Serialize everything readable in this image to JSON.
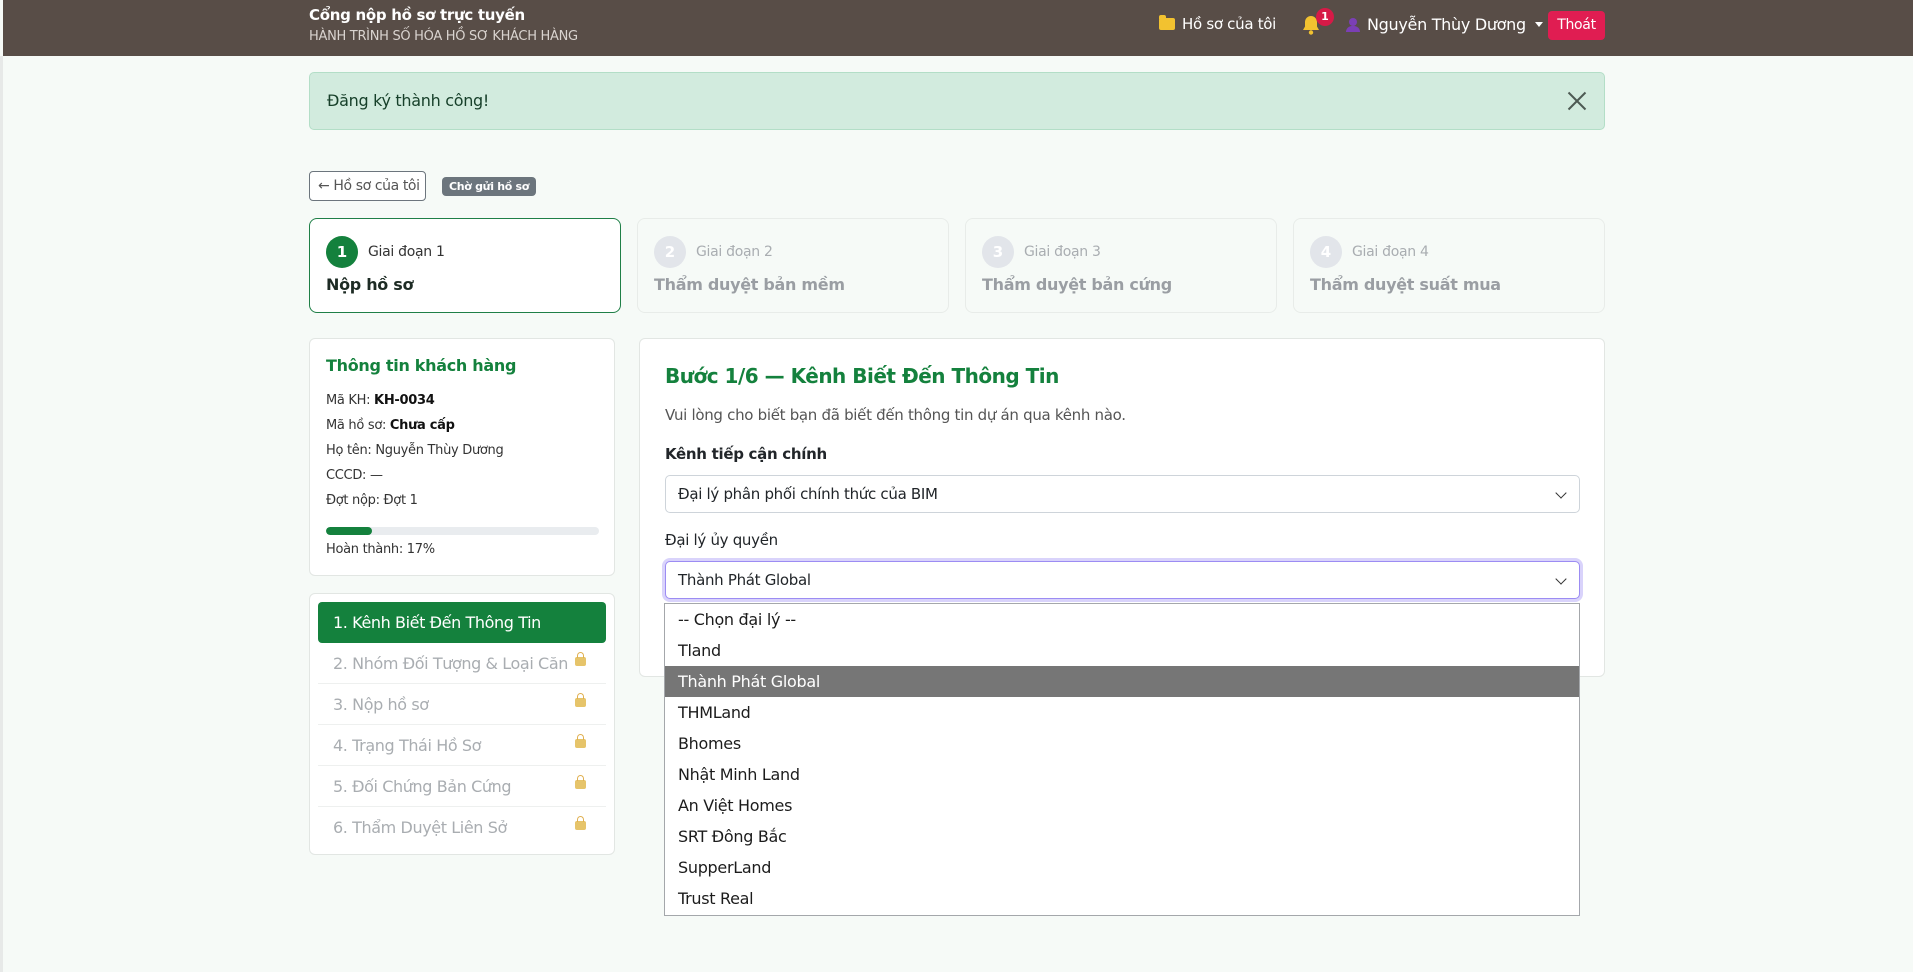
{
  "header": {
    "title": "Cổng nộp hồ sơ trực tuyến",
    "subtitle": "HÀNH TRÌNH SỐ HÓA HỒ SƠ KHÁCH HÀNG",
    "my_files": "Hồ sơ của tôi",
    "notification_count": "1",
    "user_name": "Nguyễn Thùy Dương",
    "logout": "Thoát"
  },
  "alert": {
    "message": "Đăng ký thành công!"
  },
  "toolbar": {
    "back_label": "← Hồ sơ của tôi",
    "status": "Chờ gửi hồ sơ"
  },
  "stages": [
    {
      "num": "1",
      "label": "Giai đoạn 1",
      "title": "Nộp hồ sơ"
    },
    {
      "num": "2",
      "label": "Giai đoạn 2",
      "title": "Thẩm duyệt bản mềm"
    },
    {
      "num": "3",
      "label": "Giai đoạn 3",
      "title": "Thẩm duyệt bản cứng"
    },
    {
      "num": "4",
      "label": "Giai đoạn 4",
      "title": "Thẩm duyệt suất mua"
    }
  ],
  "customer": {
    "heading": "Thông tin khách hàng",
    "customer_id_label": "Mã KH:",
    "customer_id": "KH-0034",
    "file_id_label": "Mã hồ sơ:",
    "file_id": "Chưa cấp",
    "name_label": "Họ tên:",
    "name": "Nguyễn Thùy Dương",
    "cccd_label": "CCCD:",
    "cccd": "—",
    "batch_label": "Đợt nộp:",
    "batch": "Đợt 1",
    "progress_percent": 17,
    "progress_text": "Hoàn thành: 17%"
  },
  "steps": [
    "1. Kênh Biết Đến Thông Tin",
    "2. Nhóm Đối Tượng & Loại Căn",
    "3. Nộp hồ sơ",
    "4. Trạng Thái Hồ Sơ",
    "5. Đối Chứng Bản Cứng",
    "6. Thẩm Duyệt Liên Sở"
  ],
  "form": {
    "title": "Bước 1/6 — Kênh Biết Đến Thông Tin",
    "description": "Vui lòng cho biết bạn đã biết đến thông tin dự án qua kênh nào.",
    "channel_label": "Kênh tiếp cận chính",
    "channel_value": "Đại lý phân phối chính thức của BIM",
    "agent_label": "Đại lý ủy quyền",
    "agent_value": "Thành Phát Global"
  },
  "agent_options": [
    "-- Chọn đại lý --",
    "Tland",
    "Thành Phát Global",
    "THMLand",
    "Bhomes",
    "Nhật Minh Land",
    "An Việt Homes",
    "SRT Đông Bắc",
    "SupperLand",
    "Trust Real"
  ],
  "selected_option_index": 2,
  "colors": {
    "primary": "#14813d",
    "header": "#584d47",
    "danger": "#e01d52",
    "alert_bg": "#d2ebde"
  }
}
